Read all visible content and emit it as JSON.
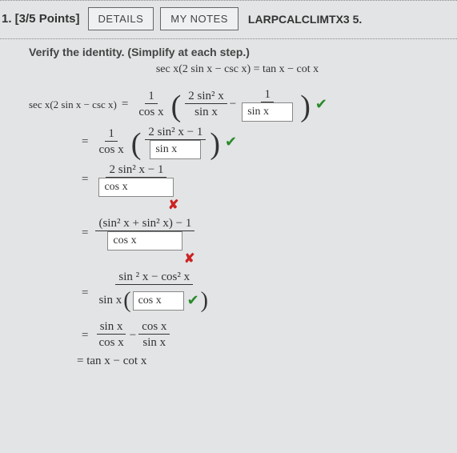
{
  "header": {
    "qnum": "1. [3/5 Points]",
    "details": "DETAILS",
    "notes": "MY NOTES",
    "book": "LARPCALCLIMTX3 5."
  },
  "prompt": "Verify the identity. (Simplify at each step.)",
  "identity": "sec x(2 sin x − csc x) = tan x − cot x",
  "s1": {
    "lhs": "sec x(2 sin x − csc x)",
    "f1n": "1",
    "f1d": "cos x",
    "f2n": "2 sin² x",
    "f2d": "sin x",
    "f3n": "1",
    "ans": "sin x"
  },
  "s2": {
    "f1n": "1",
    "f1d": "cos x",
    "topn": "2 sin² x − 1",
    "ans": "sin x"
  },
  "s3": {
    "topn": "2 sin² x − 1",
    "ans": "cos x"
  },
  "s4": {
    "topn": "(sin² x + sin² x) − 1",
    "ans": "cos x"
  },
  "s5": {
    "topn": "sin ² x − cos² x",
    "pre": "sin x",
    "ans": "cos x"
  },
  "s6": {
    "t1n": "sin x",
    "t1d": "cos x",
    "t2n": "cos x",
    "t2d": "sin x"
  },
  "s7": "= tan x − cot x"
}
